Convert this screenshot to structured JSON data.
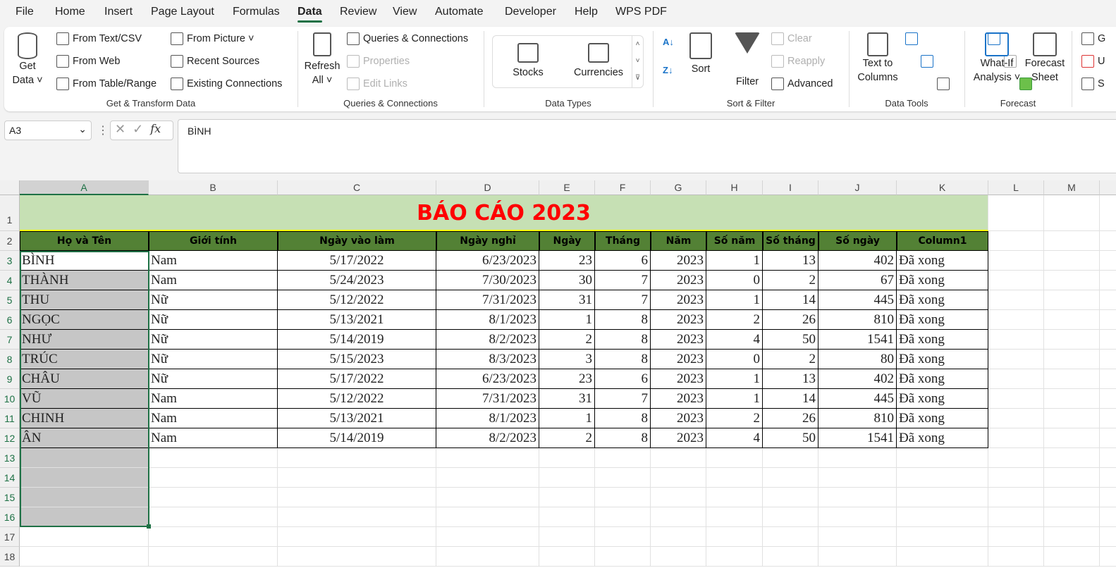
{
  "menu": [
    "File",
    "Home",
    "Insert",
    "Page Layout",
    "Formulas",
    "Data",
    "Review",
    "View",
    "Automate",
    "Developer",
    "Help",
    "WPS PDF"
  ],
  "active_tab": "Data",
  "ribbon": {
    "get_data": [
      "Get",
      "Data ˅"
    ],
    "get_transform": [
      "From Text/CSV",
      "From Web",
      "From Table/Range",
      "From Picture ˅",
      "Recent Sources",
      "Existing Connections"
    ],
    "get_transform_label": "Get & Transform Data",
    "refresh": [
      "Refresh",
      "All ˅"
    ],
    "queries": [
      "Queries & Connections",
      "Properties",
      "Edit Links"
    ],
    "queries_label": "Queries & Connections",
    "stocks": "Stocks",
    "currencies": "Currencies",
    "data_types_label": "Data Types",
    "sort": "Sort",
    "filter": "Filter",
    "clear": "Clear",
    "reapply": "Reapply",
    "advanced": "Advanced",
    "sort_filter_label": "Sort & Filter",
    "text_to_columns": [
      "Text to",
      "Columns"
    ],
    "data_tools_label": "Data Tools",
    "what_if": [
      "What-If",
      "Analysis ˅"
    ],
    "forecast_sheet": [
      "Forecast",
      "Sheet"
    ],
    "forecast_label": "Forecast",
    "outline": [
      "G",
      "U",
      "S"
    ]
  },
  "formula_bar": {
    "name_box": "A3",
    "fx": "fx",
    "value": "BÌNH"
  },
  "columns": [
    "A",
    "B",
    "C",
    "D",
    "E",
    "F",
    "G",
    "H",
    "I",
    "J",
    "K",
    "L",
    "M"
  ],
  "rows": [
    "1",
    "2",
    "3",
    "4",
    "5",
    "6",
    "7",
    "8",
    "9",
    "10",
    "11",
    "12",
    "13",
    "14",
    "15",
    "16",
    "17",
    "18"
  ],
  "title": "BÁO CÁO 2023",
  "headers": [
    "Họ và Tên",
    "Giới tính",
    "Ngày vào làm",
    "Ngày nghỉ",
    "Ngày",
    "Tháng",
    "Năm",
    "Số năm",
    "Số tháng",
    "Số ngày",
    "Column1"
  ],
  "table": [
    [
      "BÌNH",
      "Nam",
      "5/17/2022",
      "6/23/2023",
      "23",
      "6",
      "2023",
      "1",
      "13",
      "402",
      "Đã xong"
    ],
    [
      "THÀNH",
      "Nam",
      "5/24/2023",
      "7/30/2023",
      "30",
      "7",
      "2023",
      "0",
      "2",
      "67",
      "Đã xong"
    ],
    [
      "THU",
      "Nữ",
      "5/12/2022",
      "7/31/2023",
      "31",
      "7",
      "2023",
      "1",
      "14",
      "445",
      "Đã xong"
    ],
    [
      "NGỌC",
      "Nữ",
      "5/13/2021",
      "8/1/2023",
      "1",
      "8",
      "2023",
      "2",
      "26",
      "810",
      "Đã xong"
    ],
    [
      "NHƯ",
      "Nữ",
      "5/14/2019",
      "8/2/2023",
      "2",
      "8",
      "2023",
      "4",
      "50",
      "1541",
      "Đã xong"
    ],
    [
      "TRÚC",
      "Nữ",
      "5/15/2023",
      "8/3/2023",
      "3",
      "8",
      "2023",
      "0",
      "2",
      "80",
      "Đã xong"
    ],
    [
      "CHÂU",
      "Nữ",
      "5/17/2022",
      "6/23/2023",
      "23",
      "6",
      "2023",
      "1",
      "13",
      "402",
      "Đã xong"
    ],
    [
      "VŨ",
      "Nam",
      "5/12/2022",
      "7/31/2023",
      "31",
      "7",
      "2023",
      "1",
      "14",
      "445",
      "Đã xong"
    ],
    [
      "CHINH",
      "Nam",
      "5/13/2021",
      "8/1/2023",
      "1",
      "8",
      "2023",
      "2",
      "26",
      "810",
      "Đã xong"
    ],
    [
      "ÂN",
      "Nam",
      "5/14/2019",
      "8/2/2023",
      "2",
      "8",
      "2023",
      "4",
      "50",
      "1541",
      "Đã xong"
    ]
  ],
  "colors": {
    "accent": "#1e7145",
    "title": "#ff0000",
    "title_bg": "#c6e0b4",
    "header_bg": "#538135",
    "selection": "#c6c6c6"
  }
}
